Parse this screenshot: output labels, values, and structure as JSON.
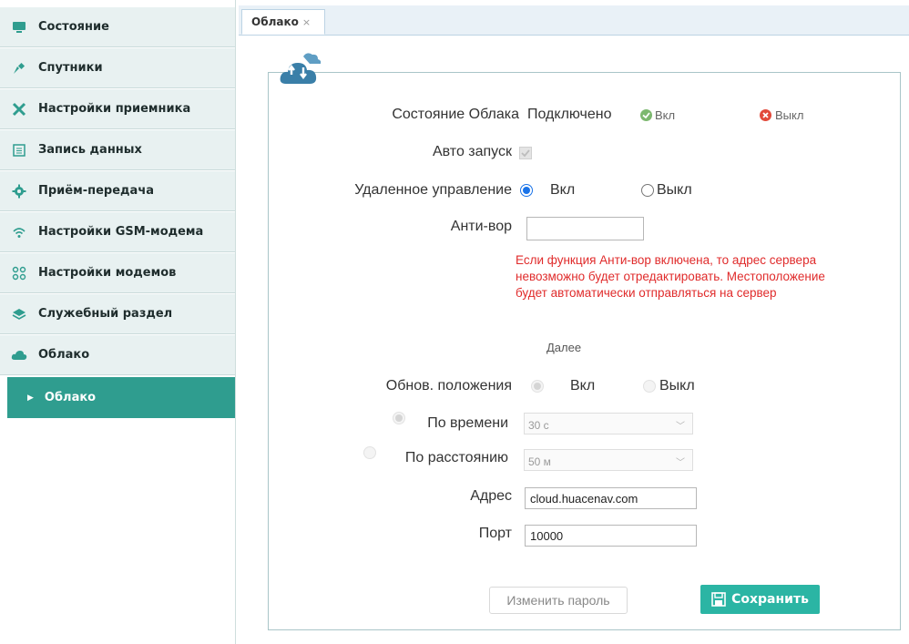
{
  "colors": {
    "accent": "#2f9d8f",
    "save": "#2bb5a4",
    "warning": "#e02b2b",
    "radio": "#1a73e8"
  },
  "sidebar": {
    "items": [
      {
        "label": "Состояние",
        "icon": "monitor-icon"
      },
      {
        "label": "Спутники",
        "icon": "satellite-icon"
      },
      {
        "label": "Настройки приемника",
        "icon": "tools-icon"
      },
      {
        "label": "Запись данных",
        "icon": "list-icon"
      },
      {
        "label": "Приём-передача",
        "icon": "gear-icon"
      },
      {
        "label": "Настройки GSM-модема",
        "icon": "wifi-icon"
      },
      {
        "label": "Настройки модемов",
        "icon": "network-icon"
      },
      {
        "label": "Служебный раздел",
        "icon": "layers-icon"
      },
      {
        "label": "Облако",
        "icon": "cloud-icon"
      }
    ],
    "sub_item": {
      "label": "Облако"
    }
  },
  "tabs": [
    {
      "label": "Облако",
      "close": "×"
    }
  ],
  "form": {
    "cloud_status": {
      "label": "Состояние Облака",
      "value": "Подключено",
      "on_label": "Вкл",
      "off_label": "Выкл"
    },
    "auto_start": {
      "label": "Авто запуск",
      "checked": true
    },
    "remote_control": {
      "label": "Удаленное управление",
      "on_label": "Вкл",
      "off_label": "Выкл",
      "selected": "on"
    },
    "anti_theft": {
      "label": "Анти-вор",
      "value": "",
      "warning": "Если функция Анти-вор включена, то адрес сервера невозможно будет отредактировать. Местоположение будет автоматически отправляться на сервер"
    },
    "next_label": "Далее",
    "position_update": {
      "label": "Обнов. положения",
      "on_label": "Вкл",
      "off_label": "Выкл"
    },
    "by_time": {
      "label": "По времени",
      "value": "30 с"
    },
    "by_distance": {
      "label": "По расстоянию",
      "value": "50 м"
    },
    "address": {
      "label": "Адрес",
      "value": "cloud.huacenav.com"
    },
    "port": {
      "label": "Порт",
      "value": "10000"
    },
    "change_password": "Изменить пароль",
    "save": "Сохранить"
  }
}
